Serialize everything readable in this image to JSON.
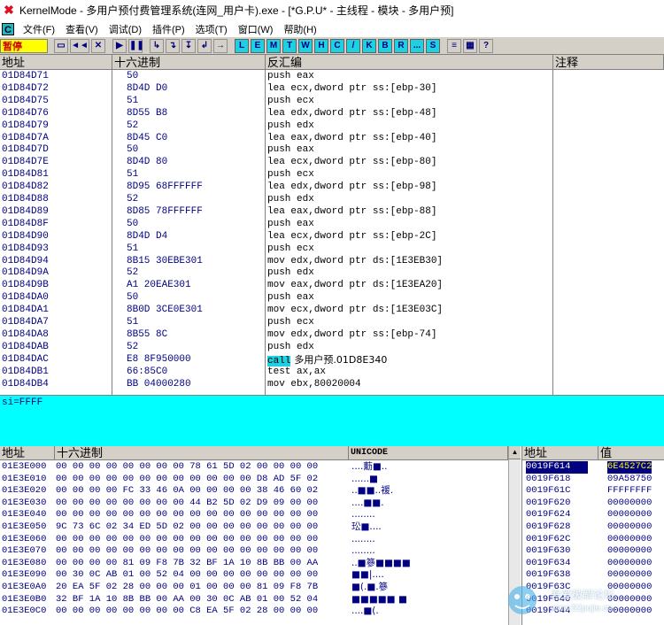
{
  "window": {
    "title": "KernelMode - 多用户预付费管理系统(连网_用户卡).exe - [*G.P.U* - 主线程 - 模块 - 多用户预]"
  },
  "menu": {
    "logo": "C",
    "items": [
      "文件(F)",
      "查看(V)",
      "调试(D)",
      "插件(P)",
      "选项(T)",
      "窗口(W)",
      "帮助(H)"
    ]
  },
  "toolbar": {
    "status": "暂停",
    "nav_buttons": [
      "◄◄",
      "✕"
    ],
    "run_buttons": [
      "▶",
      "❚❚"
    ],
    "step_buttons": [
      "↳",
      "↴",
      "↧",
      "↲",
      "→"
    ],
    "letter_buttons": [
      "L",
      "E",
      "M",
      "T",
      "W",
      "H",
      "C",
      "/",
      "K",
      "B",
      "R",
      "...",
      "S"
    ]
  },
  "disasm": {
    "headers": {
      "address": "地址",
      "hex": "十六进制",
      "disasm": "反汇编",
      "comment": "注释"
    },
    "rows": [
      {
        "addr": "01D84D71",
        "hex": "50",
        "asm": "push eax"
      },
      {
        "addr": "01D84D72",
        "hex": "8D4D D0",
        "asm": "lea ecx,dword ptr ss:[ebp-30]"
      },
      {
        "addr": "01D84D75",
        "hex": "51",
        "asm": "push ecx"
      },
      {
        "addr": "01D84D76",
        "hex": "8D55 B8",
        "asm": "lea edx,dword ptr ss:[ebp-48]"
      },
      {
        "addr": "01D84D79",
        "hex": "52",
        "asm": "push edx"
      },
      {
        "addr": "01D84D7A",
        "hex": "8D45 C0",
        "asm": "lea eax,dword ptr ss:[ebp-40]"
      },
      {
        "addr": "01D84D7D",
        "hex": "50",
        "asm": "push eax"
      },
      {
        "addr": "01D84D7E",
        "hex": "8D4D 80",
        "asm": "lea ecx,dword ptr ss:[ebp-80]"
      },
      {
        "addr": "01D84D81",
        "hex": "51",
        "asm": "push ecx"
      },
      {
        "addr": "01D84D82",
        "hex": "8D95 68FFFFFF",
        "asm": "lea edx,dword ptr ss:[ebp-98]"
      },
      {
        "addr": "01D84D88",
        "hex": "52",
        "asm": "push edx"
      },
      {
        "addr": "01D84D89",
        "hex": "8D85 78FFFFFF",
        "asm": "lea eax,dword ptr ss:[ebp-88]"
      },
      {
        "addr": "01D84D8F",
        "hex": "50",
        "asm": "push eax"
      },
      {
        "addr": "01D84D90",
        "hex": "8D4D D4",
        "asm": "lea ecx,dword ptr ss:[ebp-2C]"
      },
      {
        "addr": "01D84D93",
        "hex": "51",
        "asm": "push ecx"
      },
      {
        "addr": "01D84D94",
        "hex": "8B15 30EBE301",
        "asm": "mov edx,dword ptr ds:[1E3EB30]"
      },
      {
        "addr": "01D84D9A",
        "hex": "52",
        "asm": "push edx"
      },
      {
        "addr": "01D84D9B",
        "hex": "A1 20EAE301",
        "asm": "mov eax,dword ptr ds:[1E3EA20]"
      },
      {
        "addr": "01D84DA0",
        "hex": "50",
        "asm": "push eax"
      },
      {
        "addr": "01D84DA1",
        "hex": "8B0D 3CE0E301",
        "asm": "mov ecx,dword ptr ds:[1E3E03C]"
      },
      {
        "addr": "01D84DA7",
        "hex": "51",
        "asm": "push ecx"
      },
      {
        "addr": "01D84DA8",
        "hex": "8B55 8C",
        "asm": "mov edx,dword ptr ss:[ebp-74]"
      },
      {
        "addr": "01D84DAB",
        "hex": "52",
        "asm": "push edx"
      },
      {
        "addr": "01D84DAC",
        "hex": "E8 8F950000",
        "asm_kw": "call",
        "asm_target": "多用户预.01D8E340"
      },
      {
        "addr": "01D84DB1",
        "hex": "66:85C0",
        "asm": "test ax,ax"
      },
      {
        "addr": "01D84DB4",
        "hex": "BB 04000280",
        "asm": "mov ebx,80020004"
      }
    ]
  },
  "info": {
    "text": "si=FFFF"
  },
  "dump": {
    "headers": {
      "address": "地址",
      "hex": "十六进制",
      "unicode": "UNICODE"
    },
    "rows": [
      {
        "addr": "01E3E000",
        "hex": "00 00 00 00 00 00 00 00 78 61 5D 02 00 00 00 00",
        "uni": "....蘍■.."
      },
      {
        "addr": "01E3E010",
        "hex": "00 00 00 00 00 00 00 00 00 00 00 00 D8 AD 5F 02",
        "uni": "......■"
      },
      {
        "addr": "01E3E020",
        "hex": "00 00 00 00 FC 33 46 0A 00 00 00 00 38 46 60 02",
        "uni": "..■■..褑."
      },
      {
        "addr": "01E3E030",
        "hex": "00 00 00 00 00 00 00 00 44 B2 5D 02 D9 09 00 00",
        "uni": "....■■."
      },
      {
        "addr": "01E3E040",
        "hex": "00 00 00 00 00 00 00 00 00 00 00 00 00 00 00 00",
        "uni": "........"
      },
      {
        "addr": "01E3E050",
        "hex": "9C 73 6C 02 34 ED 5D 02 00 00 00 00 00 00 00 00",
        "uni": "玜■...."
      },
      {
        "addr": "01E3E060",
        "hex": "00 00 00 00 00 00 00 00 00 00 00 00 00 00 00 00",
        "uni": "........"
      },
      {
        "addr": "01E3E070",
        "hex": "00 00 00 00 00 00 00 00 00 00 00 00 00 00 00 00",
        "uni": "........"
      },
      {
        "addr": "01E3E080",
        "hex": "00 00 00 00 81 09 F8 7B 32 BF 1A 10 8B BB 00 AA",
        "uni": "..■篸■■■■"
      },
      {
        "addr": "01E3E090",
        "hex": "00 30 0C AB 01 00 52 04 00 00 00 00 00 00 00 00",
        "uni": "■■|...."
      },
      {
        "addr": "01E3E0A0",
        "hex": "20 EA 5F 02 28 00 00 00 01 00 00 00 81 09 F8 7B",
        "uni": "■(.■.篸"
      },
      {
        "addr": "01E3E0B0",
        "hex": "32 BF 1A 10 8B BB 00 AA 00 30 0C AB 01 00 52 04",
        "uni": "■■■■■ ■"
      },
      {
        "addr": "01E3E0C0",
        "hex": "00 00 00 00 00 00 00 00 C8 EA 5F 02 28 00 00 00",
        "uni": "....■(."
      }
    ]
  },
  "stack": {
    "headers": {
      "address": "地址",
      "value": "值"
    },
    "rows": [
      {
        "addr": "0019F614",
        "val": "6E4527C2",
        "selected": true
      },
      {
        "addr": "0019F618",
        "val": "09A58750"
      },
      {
        "addr": "0019F61C",
        "val": "FFFFFFFF"
      },
      {
        "addr": "0019F620",
        "val": "00000000"
      },
      {
        "addr": "0019F624",
        "val": "00000000"
      },
      {
        "addr": "0019F628",
        "val": "00000000"
      },
      {
        "addr": "0019F62C",
        "val": "00000000"
      },
      {
        "addr": "0019F630",
        "val": "00000000"
      },
      {
        "addr": "0019F634",
        "val": "00000000"
      },
      {
        "addr": "0019F638",
        "val": "00000000"
      },
      {
        "addr": "0019F63C",
        "val": "00000000"
      },
      {
        "addr": "0019F640",
        "val": "00000000"
      },
      {
        "addr": "0019F644",
        "val": "00000000"
      }
    ]
  },
  "watermark": {
    "text": "吾爱破解论坛",
    "sub": "www.52pojie.cn"
  },
  "colors": {
    "info_bg": "#00FFFF",
    "call_highlight": "#1FD1E0",
    "pause_bg": "#FFFF00",
    "selection": "#000080"
  }
}
